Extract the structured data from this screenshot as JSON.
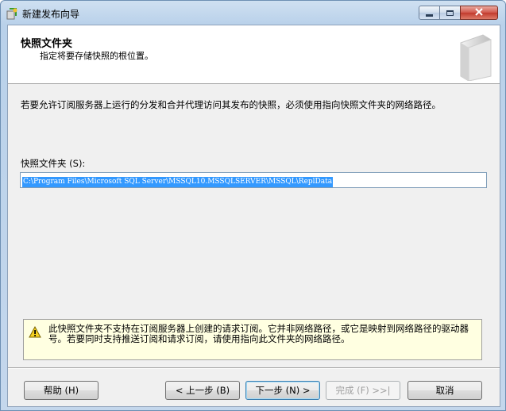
{
  "window": {
    "title": "新建发布向导",
    "minimize_glyph": "—",
    "maximize_glyph": "□",
    "close_glyph": "✕"
  },
  "header": {
    "title": "快照文件夹",
    "subtitle": "指定将要存储快照的根位置。"
  },
  "main": {
    "description": "若要允许订阅服务器上运行的分发和合并代理访问其发布的快照，必须使用指向快照文件夹的网络路径。",
    "folder_label": "快照文件夹",
    "folder_label_hotkey": "(S):",
    "folder_value": "C:\\Program Files\\Microsoft SQL Server\\MSSQL10.MSSQLSERVER\\MSSQL\\ReplData"
  },
  "warning": {
    "icon": "warning-icon",
    "text": "此快照文件夹不支持在订阅服务器上创建的请求订阅。它并非网络路径，或它是映射到网络路径的驱动器号。若要同时支持推送订阅和请求订阅，请使用指向此文件夹的网络路径。"
  },
  "buttons": {
    "help": "帮助 (H)",
    "prev": "< 上一步 (B)",
    "next": "下一步 (N) >",
    "finish": "完成 (F) >>|",
    "cancel": "取消"
  },
  "colors": {
    "title_bar": "#c4d7ec",
    "selection": "#3399ff",
    "warning_bg": "#ffffe1",
    "close_button": "#c13a2d"
  }
}
